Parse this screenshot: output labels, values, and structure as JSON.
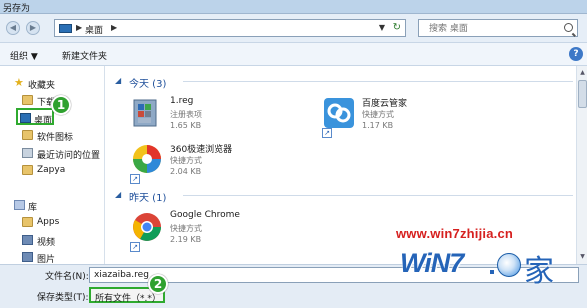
{
  "window": {
    "title": "另存为"
  },
  "address": {
    "crumb": "桌面",
    "arrow_left": "◀",
    "arrow_right": "▶",
    "dropdown": "▼",
    "refresh": "↻",
    "search_placeholder": "搜索 桌面"
  },
  "toolbar": {
    "organize": "组织 ▼",
    "new_folder": "新建文件夹",
    "help": "?"
  },
  "nav": {
    "items": [
      {
        "label": "收藏夹",
        "icon": "star-icon"
      },
      {
        "label": "下载",
        "icon": "folder-icon"
      },
      {
        "label": "桌面",
        "icon": "desktop-icon"
      },
      {
        "label": "软件图标",
        "icon": "folder-icon"
      },
      {
        "label": "最近访问的位置",
        "icon": "recent-places-icon"
      },
      {
        "label": "Zapya",
        "icon": "folder-icon"
      },
      {
        "label": "库",
        "icon": "library-icon"
      },
      {
        "label": "Apps",
        "icon": "folder-icon"
      },
      {
        "label": "视频",
        "icon": "video-icon"
      },
      {
        "label": "图片",
        "icon": "picture-icon"
      }
    ]
  },
  "groups": [
    {
      "label": "今天 (3)",
      "files": [
        {
          "name": "1.reg",
          "type": "注册表项",
          "size": "1.65 KB",
          "icon": "registry-icon"
        },
        {
          "name": "百度云管家",
          "type": "快捷方式",
          "size": "1.17 KB",
          "icon": "baidu-cloud-icon"
        },
        {
          "name": "360极速浏览器",
          "type": "快捷方式",
          "size": "2.04 KB",
          "icon": "360-browser-icon"
        }
      ]
    },
    {
      "label": "昨天 (1)",
      "files": [
        {
          "name": "Google Chrome",
          "type": "快捷方式",
          "size": "2.19 KB",
          "icon": "chrome-icon"
        }
      ]
    }
  ],
  "bottom": {
    "filename_label": "文件名(N):",
    "filename_value": "xiazaiba.reg",
    "type_label": "保存类型(T):",
    "type_value": "所有文件（*.*）"
  },
  "annotations": {
    "badge1": "1",
    "badge2": "2"
  },
  "watermark": {
    "url": "www.win7zhijia.cn",
    "logo": "WiN7",
    "dot": "",
    "jia": "家"
  },
  "colors": {
    "highlight": "#2faa2f",
    "accent": "#1e4f9a",
    "watermark_red": "#d6201f",
    "watermark_blue": "#2564b8"
  }
}
